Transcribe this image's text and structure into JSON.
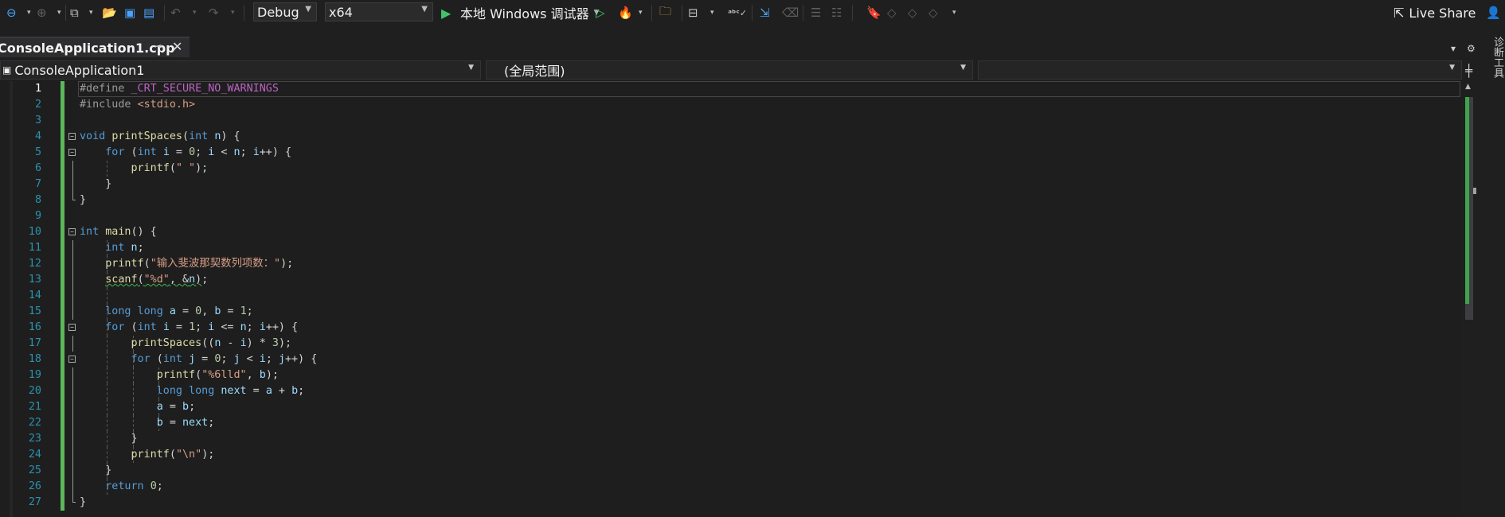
{
  "toolbar": {
    "config": "Debug",
    "platform": "x64",
    "debugger": "本地 Windows 调试器",
    "live_share": "Live Share"
  },
  "tab": {
    "filename": "ConsoleApplication1.cpp"
  },
  "nav": {
    "project": "ConsoleApplication1",
    "scope": "(全局范围)",
    "member": ""
  },
  "side_panel": {
    "label": "诊断工具"
  },
  "icons": [
    "back-icon",
    "forward-icon",
    "new-project-icon",
    "open-folder-icon",
    "save-icon",
    "save-all-icon",
    "undo-icon",
    "redo-icon",
    "start-debug-icon",
    "start-without-debug-icon",
    "hot-reload-icon",
    "solution-explorer-icon",
    "layout-icon",
    "spell-check-icon",
    "comment-icon",
    "uncomment-icon",
    "bookmark-icon",
    "live-share-icon",
    "settings-icon",
    "split-editor-icon"
  ],
  "colors": {
    "keyword": "#569cd6",
    "function": "#dcdcaa",
    "string": "#d69d85",
    "line_number": "#2b91af",
    "change_bar": "#5bb85b"
  },
  "editor": {
    "current_line": 1,
    "lines": [
      {
        "n": "1",
        "tokens": [
          [
            "pp",
            "#define "
          ],
          [
            "macro",
            "_CRT_SECURE_NO_WARNINGS"
          ]
        ]
      },
      {
        "n": "2",
        "tokens": [
          [
            "pp",
            "#include "
          ],
          [
            "str",
            "<stdio.h>"
          ]
        ]
      },
      {
        "n": "3",
        "tokens": []
      },
      {
        "n": "4",
        "tokens": [
          [
            "kw",
            "void"
          ],
          [
            "pl",
            " "
          ],
          [
            "fn",
            "printSpaces"
          ],
          [
            "pl",
            "("
          ],
          [
            "kw",
            "int"
          ],
          [
            "pl",
            " "
          ],
          [
            "var",
            "n"
          ],
          [
            "pl",
            ") {"
          ]
        ]
      },
      {
        "n": "5",
        "tokens": [
          [
            "pl",
            "    "
          ],
          [
            "kw",
            "for"
          ],
          [
            "pl",
            " ("
          ],
          [
            "kw",
            "int"
          ],
          [
            "pl",
            " "
          ],
          [
            "var",
            "i"
          ],
          [
            "pl",
            " = "
          ],
          [
            "num",
            "0"
          ],
          [
            "pl",
            "; "
          ],
          [
            "var",
            "i"
          ],
          [
            "pl",
            " < "
          ],
          [
            "var",
            "n"
          ],
          [
            "pl",
            "; "
          ],
          [
            "var",
            "i"
          ],
          [
            "pl",
            "++) {"
          ]
        ]
      },
      {
        "n": "6",
        "tokens": [
          [
            "pl",
            "        "
          ],
          [
            "fn",
            "printf"
          ],
          [
            "pl",
            "("
          ],
          [
            "str",
            "\" \""
          ],
          [
            "pl",
            ");"
          ]
        ]
      },
      {
        "n": "7",
        "tokens": [
          [
            "pl",
            "    }"
          ]
        ]
      },
      {
        "n": "8",
        "tokens": [
          [
            "pl",
            "}"
          ]
        ]
      },
      {
        "n": "9",
        "tokens": []
      },
      {
        "n": "10",
        "tokens": [
          [
            "kw",
            "int"
          ],
          [
            "pl",
            " "
          ],
          [
            "fn",
            "main"
          ],
          [
            "pl",
            "() {"
          ]
        ]
      },
      {
        "n": "11",
        "tokens": [
          [
            "pl",
            "    "
          ],
          [
            "kw",
            "int"
          ],
          [
            "pl",
            " "
          ],
          [
            "var",
            "n"
          ],
          [
            "pl",
            ";"
          ]
        ]
      },
      {
        "n": "12",
        "tokens": [
          [
            "pl",
            "    "
          ],
          [
            "fn",
            "printf"
          ],
          [
            "pl",
            "("
          ],
          [
            "str",
            "\"输入斐波那契数列项数：\""
          ],
          [
            "pl",
            ");"
          ]
        ]
      },
      {
        "n": "13",
        "tokens": [
          [
            "pl",
            "    "
          ],
          [
            "fn squig",
            "scanf"
          ],
          [
            "pl squig",
            "("
          ],
          [
            "str squig",
            "\"%d\""
          ],
          [
            "pl squig",
            ", &"
          ],
          [
            "var squig",
            "n"
          ],
          [
            "pl squig",
            ")"
          ],
          [
            "pl",
            ";"
          ]
        ]
      },
      {
        "n": "14",
        "tokens": []
      },
      {
        "n": "15",
        "tokens": [
          [
            "pl",
            "    "
          ],
          [
            "kw",
            "long long"
          ],
          [
            "pl",
            " "
          ],
          [
            "var",
            "a"
          ],
          [
            "pl",
            " = "
          ],
          [
            "num",
            "0"
          ],
          [
            "pl",
            ", "
          ],
          [
            "var",
            "b"
          ],
          [
            "pl",
            " = "
          ],
          [
            "num",
            "1"
          ],
          [
            "pl",
            ";"
          ]
        ]
      },
      {
        "n": "16",
        "tokens": [
          [
            "pl",
            "    "
          ],
          [
            "kw",
            "for"
          ],
          [
            "pl",
            " ("
          ],
          [
            "kw",
            "int"
          ],
          [
            "pl",
            " "
          ],
          [
            "var",
            "i"
          ],
          [
            "pl",
            " = "
          ],
          [
            "num",
            "1"
          ],
          [
            "pl",
            "; "
          ],
          [
            "var",
            "i"
          ],
          [
            "pl",
            " <= "
          ],
          [
            "var",
            "n"
          ],
          [
            "pl",
            "; "
          ],
          [
            "var",
            "i"
          ],
          [
            "pl",
            "++) {"
          ]
        ]
      },
      {
        "n": "17",
        "tokens": [
          [
            "pl",
            "        "
          ],
          [
            "fn",
            "printSpaces"
          ],
          [
            "pl",
            "(("
          ],
          [
            "var",
            "n"
          ],
          [
            "pl",
            " - "
          ],
          [
            "var",
            "i"
          ],
          [
            "pl",
            ") * "
          ],
          [
            "num",
            "3"
          ],
          [
            "pl",
            ");"
          ]
        ]
      },
      {
        "n": "18",
        "tokens": [
          [
            "pl",
            "        "
          ],
          [
            "kw",
            "for"
          ],
          [
            "pl",
            " ("
          ],
          [
            "kw",
            "int"
          ],
          [
            "pl",
            " "
          ],
          [
            "var",
            "j"
          ],
          [
            "pl",
            " = "
          ],
          [
            "num",
            "0"
          ],
          [
            "pl",
            "; "
          ],
          [
            "var",
            "j"
          ],
          [
            "pl",
            " < "
          ],
          [
            "var",
            "i"
          ],
          [
            "pl",
            "; "
          ],
          [
            "var",
            "j"
          ],
          [
            "pl",
            "++) {"
          ]
        ]
      },
      {
        "n": "19",
        "tokens": [
          [
            "pl",
            "            "
          ],
          [
            "fn",
            "printf"
          ],
          [
            "pl",
            "("
          ],
          [
            "str",
            "\"%6lld\""
          ],
          [
            "pl",
            ", "
          ],
          [
            "var",
            "b"
          ],
          [
            "pl",
            ");"
          ]
        ]
      },
      {
        "n": "20",
        "tokens": [
          [
            "pl",
            "            "
          ],
          [
            "kw",
            "long long"
          ],
          [
            "pl",
            " "
          ],
          [
            "var",
            "next"
          ],
          [
            "pl",
            " = "
          ],
          [
            "var",
            "a"
          ],
          [
            "pl",
            " + "
          ],
          [
            "var",
            "b"
          ],
          [
            "pl",
            ";"
          ]
        ]
      },
      {
        "n": "21",
        "tokens": [
          [
            "pl",
            "            "
          ],
          [
            "var",
            "a"
          ],
          [
            "pl",
            " = "
          ],
          [
            "var",
            "b"
          ],
          [
            "pl",
            ";"
          ]
        ]
      },
      {
        "n": "22",
        "tokens": [
          [
            "pl",
            "            "
          ],
          [
            "var",
            "b"
          ],
          [
            "pl",
            " = "
          ],
          [
            "var",
            "next"
          ],
          [
            "pl",
            ";"
          ]
        ]
      },
      {
        "n": "23",
        "tokens": [
          [
            "pl",
            "        }"
          ]
        ]
      },
      {
        "n": "24",
        "tokens": [
          [
            "pl",
            "        "
          ],
          [
            "fn",
            "printf"
          ],
          [
            "pl",
            "("
          ],
          [
            "str",
            "\"\\n\""
          ],
          [
            "pl",
            ");"
          ]
        ]
      },
      {
        "n": "25",
        "tokens": [
          [
            "pl",
            "    }"
          ]
        ]
      },
      {
        "n": "26",
        "tokens": [
          [
            "pl",
            "    "
          ],
          [
            "kw",
            "return"
          ],
          [
            "pl",
            " "
          ],
          [
            "num",
            "0"
          ],
          [
            "pl",
            ";"
          ]
        ]
      },
      {
        "n": "27",
        "tokens": [
          [
            "pl",
            "}"
          ]
        ]
      }
    ]
  }
}
